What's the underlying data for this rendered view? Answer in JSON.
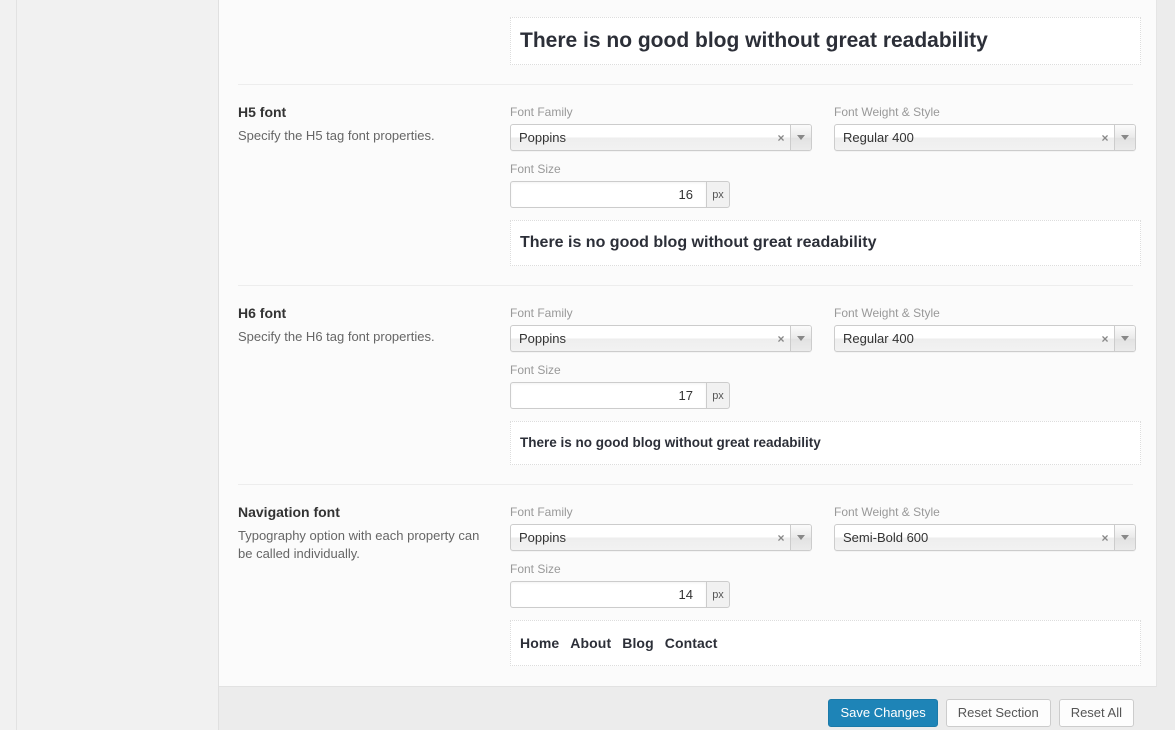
{
  "panel": {
    "sections": [
      {
        "id": "h4-partial",
        "preview_text": "There is no good blog without great readability",
        "preview_kind": "h4-prev"
      },
      {
        "id": "h5",
        "title": "H5 font",
        "description": "Specify the H5 tag font properties.",
        "font_family_label": "Font Family",
        "font_family_value": "Poppins",
        "font_weight_label": "Font Weight & Style",
        "font_weight_value": "Regular 400",
        "font_size_label": "Font Size",
        "font_size_value": "16",
        "font_size_unit": "px",
        "preview_text": "There is no good blog without great readability",
        "preview_kind": "h5-prev"
      },
      {
        "id": "h6",
        "title": "H6 font",
        "description": "Specify the H6 tag font properties.",
        "font_family_label": "Font Family",
        "font_family_value": "Poppins",
        "font_weight_label": "Font Weight & Style",
        "font_weight_value": "Regular 400",
        "font_size_label": "Font Size",
        "font_size_value": "17",
        "font_size_unit": "px",
        "preview_text": "There is no good blog without great readability",
        "preview_kind": "h6-prev"
      },
      {
        "id": "navigation",
        "title": "Navigation font",
        "description": "Typography option with each property can be called individually.",
        "font_family_label": "Font Family",
        "font_family_value": "Poppins",
        "font_weight_label": "Font Weight & Style",
        "font_weight_value": "Semi-Bold 600",
        "font_size_label": "Font Size",
        "font_size_value": "14",
        "font_size_unit": "px",
        "preview_items": [
          "Home",
          "About",
          "Blog",
          "Contact"
        ],
        "preview_kind": "nav-prev"
      }
    ]
  },
  "controls": {
    "clear_glyph": "×",
    "clear_icon_name": "clear-selection-icon",
    "dropdown_icon_name": "chevron-down-icon"
  },
  "footer": {
    "save_label": "Save Changes",
    "reset_section_label": "Reset Section",
    "reset_all_label": "Reset All"
  },
  "colors": {
    "primary": "#1e84b7",
    "panel_bg": "#fbfbfb",
    "page_bg": "#f1f1f1",
    "footer_bg": "#ececec",
    "title_text": "#333333",
    "muted_text": "#666666",
    "label_text": "#999999",
    "preview_text": "#2c2f38"
  }
}
